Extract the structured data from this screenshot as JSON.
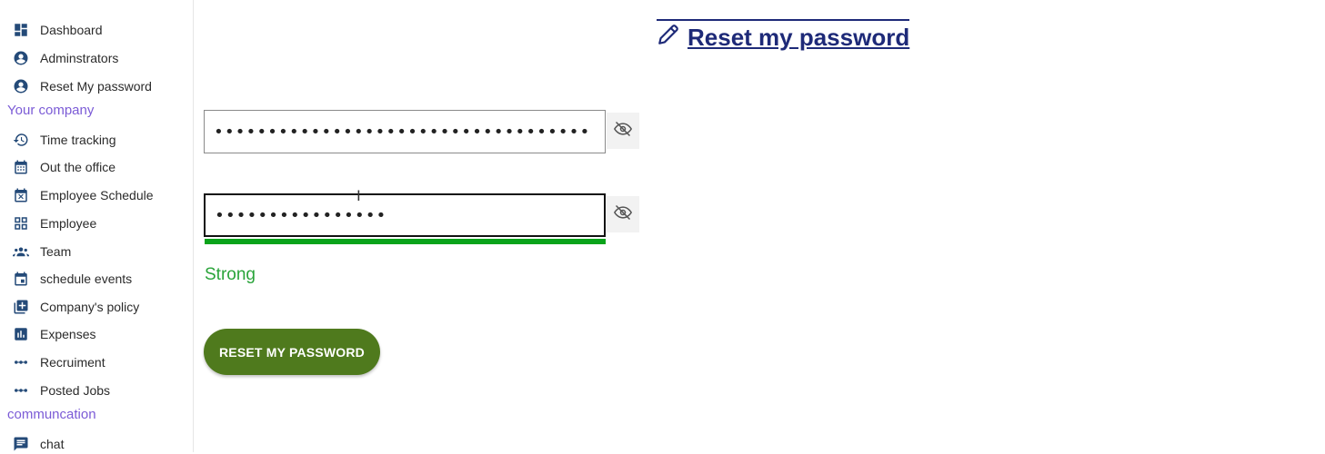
{
  "sidebar": {
    "items": [
      {
        "label": "Dashboard",
        "icon": "dashboard-icon"
      },
      {
        "label": "Adminstrators",
        "icon": "user-circle-icon"
      },
      {
        "label": "Reset My password",
        "icon": "user-circle-icon"
      },
      {
        "label": "Time tracking",
        "icon": "history-icon"
      },
      {
        "label": "Out the office",
        "icon": "calendar-icon"
      },
      {
        "label": "Employee Schedule",
        "icon": "calendar-x-icon"
      },
      {
        "label": "Employee",
        "icon": "grid-icon"
      },
      {
        "label": "Team",
        "icon": "group-icon"
      },
      {
        "label": "schedule events",
        "icon": "event-icon"
      },
      {
        "label": "Company's policy",
        "icon": "library-add-icon"
      },
      {
        "label": "Expenses",
        "icon": "bar-chart-icon"
      },
      {
        "label": "Recruiment",
        "icon": "dots-icon"
      },
      {
        "label": "Posted Jobs",
        "icon": "dots-icon"
      },
      {
        "label": "chat",
        "icon": "chat-icon"
      }
    ],
    "sections": {
      "company": "Your company",
      "communication": "communcation"
    }
  },
  "main": {
    "title": "Reset my password",
    "password_value": "•••••••••••••••••••••••••••••••••••",
    "confirm_value": "••••••••••••••••",
    "strength_label": "Strong",
    "strength_percent": 100,
    "submit_label": "RESET MY PASSWORD"
  },
  "colors": {
    "accent_purple": "#7b5bd6",
    "heading": "#1e2a78",
    "strong_green": "#2aa43a",
    "button_green": "#4f7a1d"
  }
}
